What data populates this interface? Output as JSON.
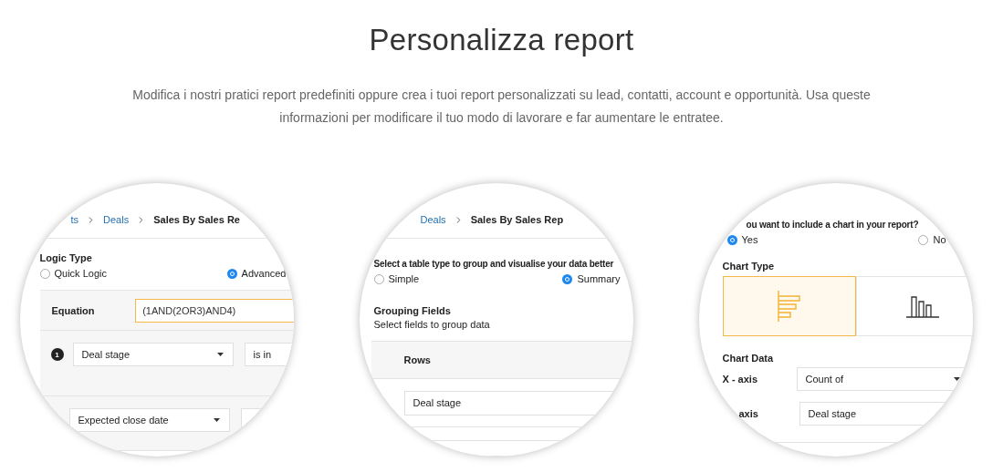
{
  "header": {
    "title": "Personalizza report",
    "description": "Modifica i nostri pratici report predefiniti oppure crea i tuoi report personalizzati su lead, contatti, account e opportunità. Usa queste informazioni per modificare il tuo modo di lavorare e far aumentare le entratee."
  },
  "panels": [
    {
      "kind": "logic",
      "breadcrumb": [
        "ts",
        "Deals",
        "Sales By Sales Re"
      ],
      "section_label": "Logic Type",
      "options": [
        {
          "label": "Quick Logic",
          "selected": false
        },
        {
          "label": "Advanced",
          "selected": true
        }
      ],
      "equation": {
        "label": "Equation",
        "value": "(1AND(2OR3)AND4)"
      },
      "conditions": [
        {
          "number": "1",
          "field": "Deal stage",
          "operator": "is in"
        },
        {
          "field": "Expected close date"
        }
      ]
    },
    {
      "kind": "grouping",
      "breadcrumb": [
        "Deals",
        "Sales By Sales Rep"
      ],
      "section_label": "Select a table type to group and visualise your data better",
      "options": [
        {
          "label": "Simple",
          "selected": false
        },
        {
          "label": "Summary",
          "selected": true
        }
      ],
      "grouping": {
        "title": "Grouping Fields",
        "hint": "Select fields to group data",
        "rows_label": "Rows",
        "rows_value": "Deal stage"
      }
    },
    {
      "kind": "chart",
      "section_label": "ou want to include a chart in your report?",
      "options": [
        {
          "label": "Yes",
          "selected": true
        },
        {
          "label": "No",
          "selected": false
        }
      ],
      "chart_type": {
        "label": "Chart Type",
        "options": [
          {
            "kind": "bar",
            "selected": true
          },
          {
            "kind": "column",
            "selected": false
          }
        ]
      },
      "axes": {
        "title": "Chart Data",
        "x": {
          "label": "X - axis",
          "value": "Count of"
        },
        "y": {
          "label": "axis",
          "value": "Deal stage"
        }
      }
    }
  ]
}
